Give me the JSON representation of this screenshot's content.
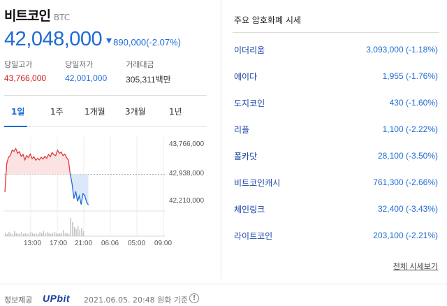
{
  "coin": {
    "name": "비트코인",
    "symbol": "BTC",
    "price": "42,048,000",
    "change": "890,000(-2.07%)",
    "stats": {
      "high_label": "당일고가",
      "high_value": "43,766,000",
      "low_label": "당일저가",
      "low_value": "42,001,000",
      "volume_label": "거래대금",
      "volume_value": "305,311백만"
    }
  },
  "tabs": [
    "1일",
    "1주",
    "1개월",
    "3개월",
    "1년"
  ],
  "active_tab": "1일",
  "chart_data": {
    "type": "line",
    "y_ticks": [
      "43,766,000",
      "42,938,000",
      "42,210,000"
    ],
    "x_ticks": [
      "13:00",
      "17:00",
      "21:00",
      "06:06",
      "05:00",
      "09:00"
    ],
    "ylim": [
      42030000,
      43900000
    ],
    "baseline": 42938000,
    "colors": {
      "up": "#e03b3b",
      "down": "#1e6bd6",
      "up_fill": "#fbe3e3",
      "down_fill": "#dbe8fa",
      "volume": "#bfbfbf"
    },
    "series": [
      {
        "values": [
          42480000,
          43210000,
          43380000,
          43420000,
          43560000,
          43530000,
          43600000,
          43480000,
          43520000,
          43400000,
          43450000,
          43310000,
          43420000,
          43370000,
          43460000,
          43340000,
          43390000,
          43300000,
          43350000,
          43310000,
          43380000,
          43330000,
          43400000,
          43350000,
          43450000,
          43390000,
          43500000,
          43440000,
          43420000,
          43560000,
          43480000,
          43510000,
          43420000,
          43460000,
          43370000,
          43300000,
          42940000
        ]
      },
      {
        "values": [
          42940000,
          42690000,
          42310000,
          42500000,
          42240000,
          42380000,
          42160000,
          42440000,
          42390000,
          42220000,
          42150000
        ]
      }
    ],
    "volume": [
      3,
      2,
      4,
      3,
      2,
      5,
      3,
      2,
      3,
      4,
      2,
      3,
      2,
      3,
      4,
      3,
      2,
      3,
      2,
      4,
      3,
      5,
      3,
      4,
      3,
      2,
      3,
      4,
      3,
      2,
      3,
      3,
      6,
      3,
      3,
      2,
      18,
      14,
      9,
      7,
      10,
      6,
      8,
      5
    ]
  },
  "market": {
    "title": "주요 암호화폐 시세",
    "coins": [
      {
        "name": "이더리움",
        "value": "3,093,000 (-1.18%)"
      },
      {
        "name": "에이다",
        "value": "1,955 (-1.76%)"
      },
      {
        "name": "도지코인",
        "value": "430 (-1.60%)"
      },
      {
        "name": "리플",
        "value": "1,100 (-2.22%)"
      },
      {
        "name": "폴카닷",
        "value": "28,100 (-3.50%)"
      },
      {
        "name": "비트코인캐시",
        "value": "761,300 (-2.66%)"
      },
      {
        "name": "체인링크",
        "value": "32,400 (-3.43%)"
      },
      {
        "name": "라이트코인",
        "value": "203,100 (-2.21%)"
      }
    ],
    "view_all": "전체 시세보기"
  },
  "footer": {
    "source_label": "정보제공",
    "logo": "UPbit",
    "timestamp": "2021.06.05. 20:48 원화 기준",
    "info_icon": "info-circle-icon"
  }
}
